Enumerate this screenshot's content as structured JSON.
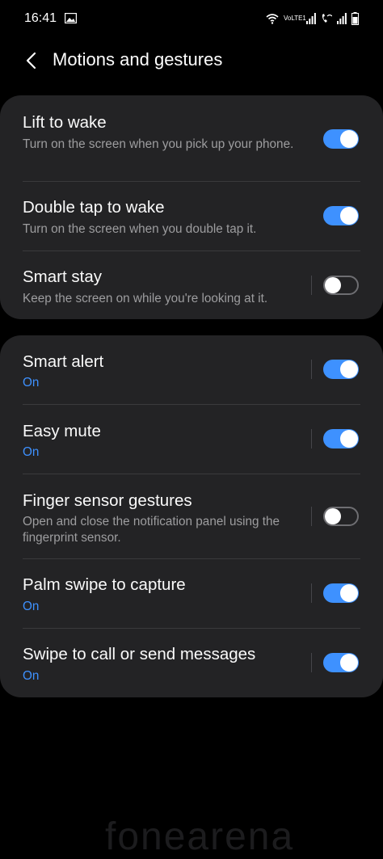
{
  "status_bar": {
    "time": "16:41",
    "network_label": "VoLTE1"
  },
  "header": {
    "title": "Motions and gestures"
  },
  "group1": [
    {
      "title": "Lift to wake",
      "subtitle": "Turn on the screen when you pick up your phone.",
      "toggle": "on"
    },
    {
      "title": "Double tap to wake",
      "subtitle": "Turn on the screen when you double tap it.",
      "toggle": "on"
    },
    {
      "title": "Smart stay",
      "subtitle": "Keep the screen on while you're looking at it.",
      "toggle": "off"
    }
  ],
  "group2": [
    {
      "title": "Smart alert",
      "subtitle": "On",
      "toggle": "on"
    },
    {
      "title": "Easy mute",
      "subtitle": "On",
      "toggle": "on"
    },
    {
      "title": "Finger sensor gestures",
      "subtitle": "Open and close the notification panel using the fingerprint sensor.",
      "toggle": "off"
    },
    {
      "title": "Palm swipe to capture",
      "subtitle": "On",
      "toggle": "on"
    },
    {
      "title": "Swipe to call or send messages",
      "subtitle": "On",
      "toggle": "on"
    }
  ],
  "watermark": "fonearena",
  "colors": {
    "accent": "#3e91ff",
    "card": "#232325",
    "background": "#000000"
  }
}
